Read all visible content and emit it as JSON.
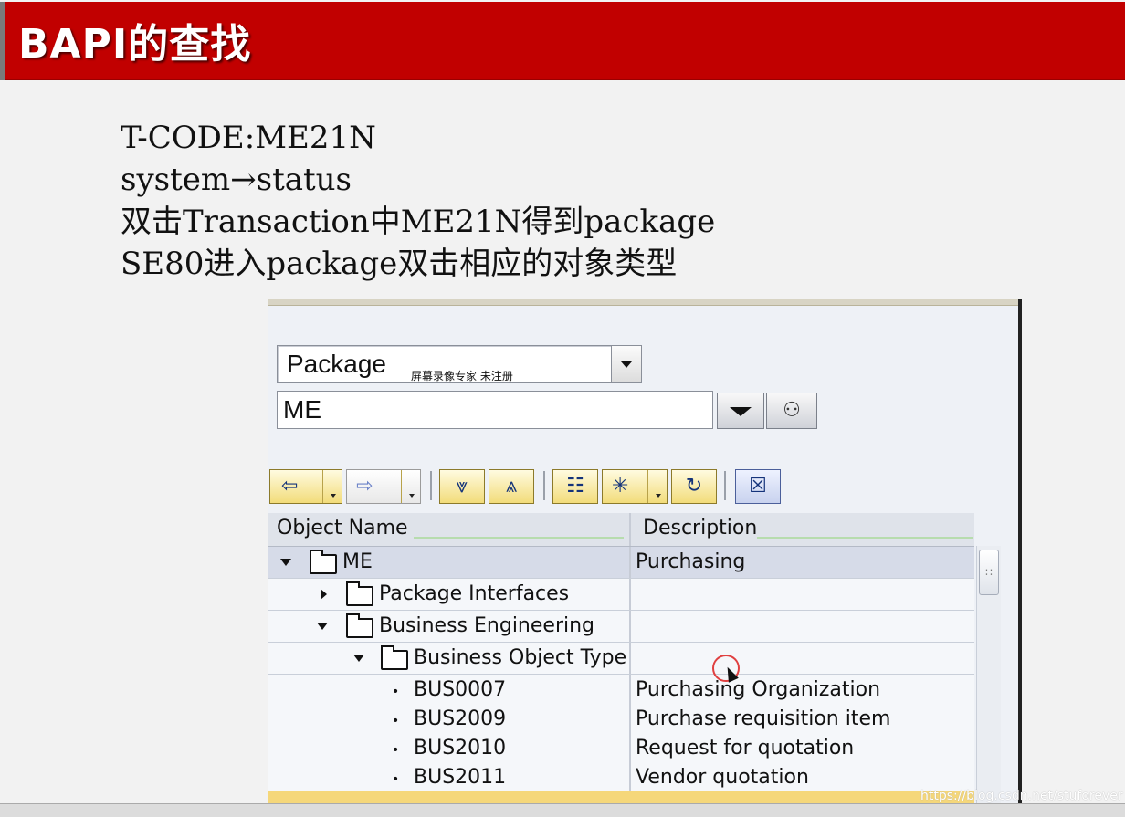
{
  "slide": {
    "title": "BAPI的查找",
    "steps": [
      "T-CODE:ME21N",
      "system→status",
      "双击Transaction中ME21N得到package",
      "SE80进入package双击相应的对象类型"
    ],
    "credit": "https://blog.csdn.net/stuforever"
  },
  "sap": {
    "object_type": "Package",
    "object_name": "ME",
    "watermark": "屏幕录像专家 未注册",
    "toolbar": {
      "back_icon": "back-arrow-icon",
      "forward_icon": "forward-arrow-icon",
      "expand_icon": "expand-all-icon",
      "collapse_icon": "collapse-all-icon",
      "hierarchy_icon": "hierarchy-icon",
      "display_icon": "display-object-icon",
      "refresh_icon": "refresh-icon",
      "close_icon": "close-icon"
    },
    "columns": {
      "name": "Object Name",
      "description": "Description"
    },
    "rows": [
      {
        "name": "ME",
        "description": "Purchasing"
      },
      {
        "name": "Package Interfaces",
        "description": ""
      },
      {
        "name": "Business Engineering",
        "description": ""
      },
      {
        "name": "Business Object Type",
        "description": ""
      },
      {
        "name": "BUS0007",
        "description": "Purchasing Organization"
      },
      {
        "name": "BUS2009",
        "description": "Purchase requisition item"
      },
      {
        "name": "BUS2010",
        "description": "Request for quotation"
      },
      {
        "name": "BUS2011",
        "description": "Vendor quotation"
      }
    ]
  }
}
